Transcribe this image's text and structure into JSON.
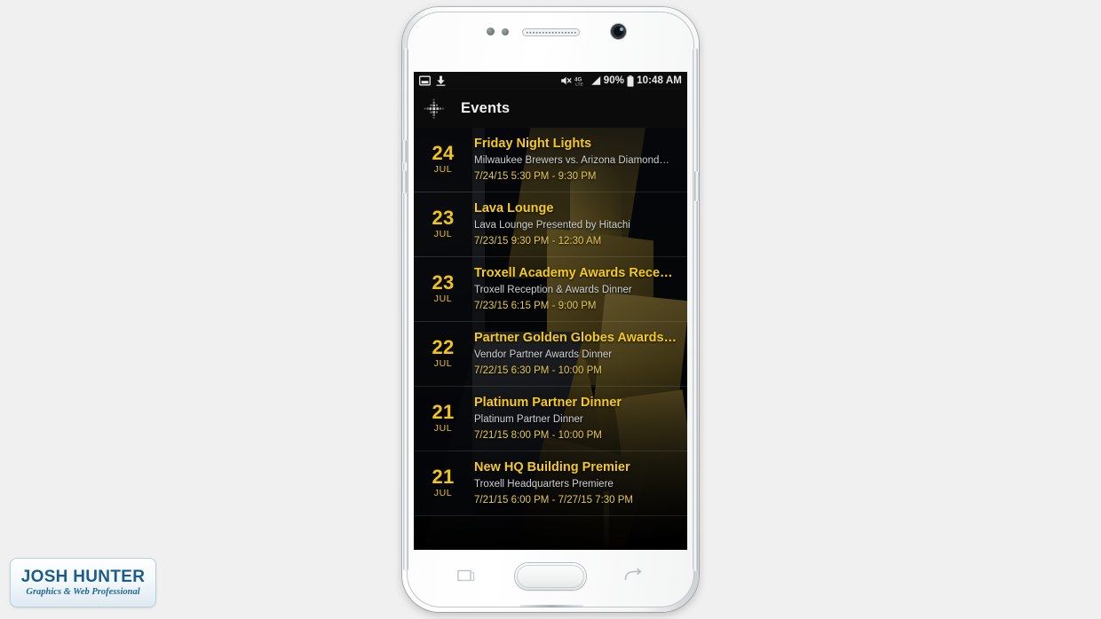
{
  "device": {
    "name": "Samsung Galaxy smartphone mockup",
    "front_camera": "front-camera",
    "earpiece": "earpiece-speaker",
    "home_button": "home-button",
    "recent_apps_button": "recent-apps-button",
    "back_button": "back-button"
  },
  "status_bar": {
    "icons": {
      "screenshot": "image-icon",
      "download": "download-icon",
      "mute": "mute-icon",
      "network": "4g-lte-icon",
      "signal": "signal-bars-icon",
      "battery": "battery-icon"
    },
    "network_label": "4G",
    "battery_percent": "90%",
    "time": "10:48 AM"
  },
  "app_bar": {
    "logo_icon": "dotted-compass-logo-icon",
    "title": "Events"
  },
  "events": [
    {
      "day": "24",
      "month": "JUL",
      "title": "Friday Night Lights",
      "subtitle": "Milwaukee Brewers vs. Arizona Diamond…",
      "time": "7/24/15 5:30 PM - 9:30 PM"
    },
    {
      "day": "23",
      "month": "JUL",
      "title": "Lava Lounge",
      "subtitle": "Lava Lounge Presented by Hitachi",
      "time": "7/23/15 9:30 PM - 12:30 AM"
    },
    {
      "day": "23",
      "month": "JUL",
      "title": "Troxell Academy Awards Rece…",
      "subtitle": "Troxell Reception & Awards Dinner",
      "time": "7/23/15 6:15 PM - 9:00 PM"
    },
    {
      "day": "22",
      "month": "JUL",
      "title": "Partner Golden Globes Awards…",
      "subtitle": "Vendor Partner Awards Dinner",
      "time": "7/22/15 6:30 PM - 10:00 PM"
    },
    {
      "day": "21",
      "month": "JUL",
      "title": "Platinum Partner Dinner",
      "subtitle": "Platinum Partner Dinner",
      "time": "7/21/15 8:00 PM - 10:00 PM"
    },
    {
      "day": "21",
      "month": "JUL",
      "title": "New HQ Building Premier",
      "subtitle": "Troxell Headquarters Premiere",
      "time": "7/21/15 6:00 PM - 7/27/15 7:30 PM"
    }
  ],
  "watermark": {
    "title": "JOSH HUNTER",
    "subtitle": "Graphics & Web Professional"
  },
  "colors": {
    "accent_yellow": "#f5cb19",
    "date_yellow": "#f0c419",
    "time_yellow": "#e4c94e",
    "subtitle_grey": "#cfd0d2",
    "screen_black": "#000000",
    "app_bar_black": "#0b0b0b",
    "status_bar_black": "#0d0d0d",
    "watermark_blue": "#1a5c8a",
    "page_background": "#f0f0f0"
  }
}
